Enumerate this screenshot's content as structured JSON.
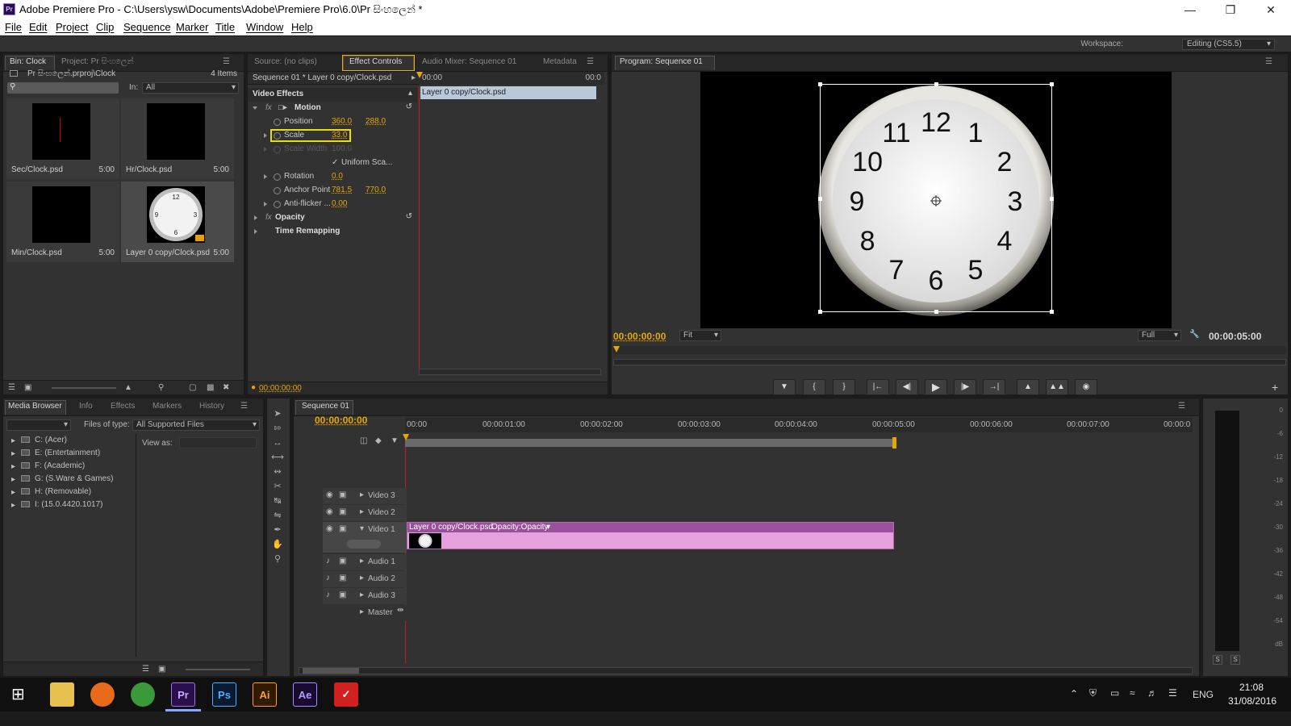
{
  "window": {
    "title": "Adobe Premiere Pro - C:\\Users\\ysw\\Documents\\Adobe\\Premiere Pro\\6.0\\Pr සිංහලෙන් *",
    "app_icon": "Pr"
  },
  "menu": [
    "File",
    "Edit",
    "Project",
    "Clip",
    "Sequence",
    "Marker",
    "Title",
    "Window",
    "Help"
  ],
  "workspace": {
    "label": "Workspace:",
    "value": "Editing (CS5.5)"
  },
  "bin": {
    "tabs": [
      "Bin: Clock",
      "Project: Pr සිංහලෙන්"
    ],
    "path": "Pr සිංහලෙන්.prproj\\Clock",
    "count": "4 Items",
    "in_label": "In:",
    "in_value": "All",
    "items": [
      {
        "name": "Sec/Clock.psd",
        "dur": "5:00"
      },
      {
        "name": "Hr/Clock.psd",
        "dur": "5:00"
      },
      {
        "name": "Min/Clock.psd",
        "dur": "5:00"
      },
      {
        "name": "Layer 0 copy/Clock.psd",
        "dur": "5:00"
      }
    ]
  },
  "effects": {
    "tabs": [
      "Source: (no clips)",
      "Effect Controls",
      "Audio Mixer: Sequence 01",
      "Metadata"
    ],
    "seq_label": "Sequence 01 * Layer 0 copy/Clock.psd",
    "time_start": "00:00",
    "time_end": "00:0",
    "clip_bar": "Layer 0 copy/Clock.psd",
    "video_effects": "Video Effects",
    "motion": "Motion",
    "position_label": "Position",
    "position_x": "360.0",
    "position_y": "288.0",
    "scale_label": "Scale",
    "scale_value": "33.0",
    "scale_width_label": "Scale Width",
    "scale_width_value": "100.0",
    "uniform_label": "Uniform Sca...",
    "rotation_label": "Rotation",
    "rotation_value": "0.0",
    "anchor_label": "Anchor Point",
    "anchor_x": "781.5",
    "anchor_y": "770.0",
    "antiflicker_label": "Anti-flicker ...",
    "antiflicker_value": "0.00",
    "opacity": "Opacity",
    "time_remap": "Time Remapping",
    "timecode": "00:00:00:00"
  },
  "program": {
    "tab": "Program: Sequence 01",
    "timecode": "00:00:00:00",
    "fit": "Fit",
    "quality": "Full",
    "duration": "00:00:05:00"
  },
  "clock_numbers": [
    "12",
    "1",
    "2",
    "3",
    "4",
    "5",
    "6",
    "7",
    "8",
    "9",
    "10",
    "11"
  ],
  "media_browser": {
    "tabs": [
      "Media Browser",
      "Info",
      "Effects",
      "Markers",
      "History"
    ],
    "files_label": "Files of type:",
    "files_value": "All Supported Files",
    "view_label": "View as:",
    "drives": [
      "C: (Acer)",
      "E: (Entertainment)",
      "F: (Academic)",
      "G: (S.Ware & Games)",
      "H: (Removable)",
      "I: (15.0.4420.1017)"
    ]
  },
  "timeline": {
    "tab": "Sequence 01",
    "timecode": "00:00:00:00",
    "ruler": [
      "00:00",
      "00:00:01:00",
      "00:00:02:00",
      "00:00:03:00",
      "00:00:04:00",
      "00:00:05:00",
      "00:00:06:00",
      "00:00:07:00",
      "00:00:0"
    ],
    "tracks": [
      "Video 3",
      "Video 2",
      "Video 1",
      "Audio 1",
      "Audio 2",
      "Audio 3",
      "Master"
    ],
    "clip_name": "Layer 0 copy/Clock.psd",
    "clip_fx": "Opacity:Opacity"
  },
  "audio_meter": {
    "scale": [
      "0",
      "-6",
      "-12",
      "-18",
      "-24",
      "-30",
      "-36",
      "-42",
      "-48",
      "-54",
      "dB"
    ],
    "solo": [
      "S",
      "S"
    ]
  },
  "taskbar": {
    "apps": [
      "Ps",
      "Ai",
      "Ae"
    ],
    "pr": "Pr",
    "lang": "ENG",
    "time": "21:08",
    "date": "31/08/2016"
  },
  "colors": {
    "accent": "#e8a600",
    "clip_video": "#e6a0de",
    "clip_header": "#9c4f9c"
  }
}
